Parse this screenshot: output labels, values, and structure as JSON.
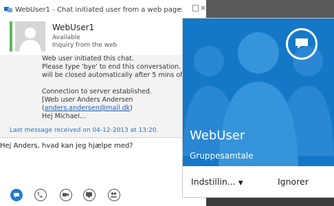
{
  "window": {
    "title": "WebUser1 - Chat initiated user from a web page.",
    "minimize": "–",
    "maximize": "□",
    "close": "×"
  },
  "contact": {
    "name": "WebUser1",
    "status": "Available",
    "subtitle": "Inquiry from the web",
    "presence_color": "#5cb85c"
  },
  "conversation": {
    "lines": [
      "Web user initiated this chat.",
      "Please type 'bye' to end this conversation. Otherwis",
      "will be closed automatically after 5 mins of inactivit",
      "Connection to server established.",
      "[Web user Anders Andersen",
      "(anders.andersen@mail.dk)",
      "Hej Michael..."
    ],
    "email": "anders.andersen@mail.dk",
    "last_message": "Last message received on 04-12-2013 at 13:20."
  },
  "compose": {
    "value": "Hej Anders, hvad kan jeg hjælpe med?"
  },
  "modes": {
    "icons": [
      "im-icon",
      "phone-icon",
      "video-icon",
      "screen-share-icon",
      "people-icon"
    ],
    "accent": "#1f7bd1"
  },
  "toast": {
    "name": "WebUser",
    "subtitle": "Gruppesamtale",
    "settings_label": "Indstillin...",
    "settings_arrow": "▼",
    "ignore_label": "Ignorer",
    "background": "#1478c8"
  }
}
